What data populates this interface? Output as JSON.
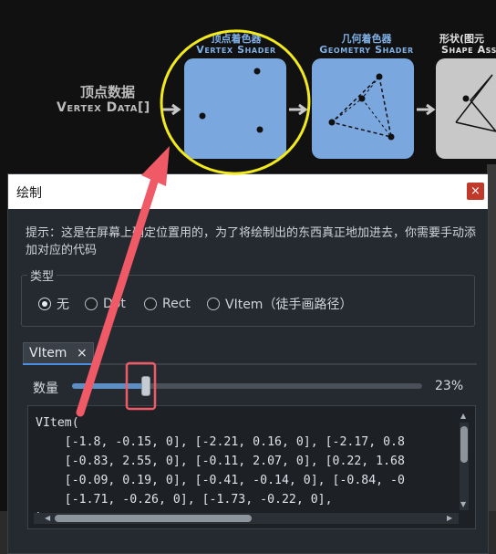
{
  "background_figure": {
    "vertex_data_label": "顶点数据",
    "vertex_data_sub": "Vertex Data[]",
    "stages": [
      {
        "title": "顶点着色器",
        "sub": "Vertex Shader"
      },
      {
        "title": "几何着色器",
        "sub": "Geometry Shader"
      },
      {
        "title": "形状(图元",
        "sub": "Shape Ass"
      }
    ]
  },
  "dialog": {
    "title": "绘制",
    "close_glyph": "×",
    "hint": "提示：这是在屏幕上确定位置用的，为了将绘制出的东西真正地加进去，你需要手动添加对应的代码",
    "type_group": {
      "label": "类型",
      "options": [
        "无",
        "Dot",
        "Rect",
        "VItem（徒手画路径）"
      ],
      "selected": "无"
    },
    "tab": {
      "label": "VItem",
      "close_glyph": "×"
    },
    "quantity": {
      "label": "数量",
      "percent_text": "23%",
      "value": 0.21
    },
    "code_lines": [
      "VItem(",
      "    [-1.8, -0.15, 0], [-2.21, 0.16, 0], [-2.17, 0.8",
      "    [-0.83, 2.55, 0], [-0.11, 2.07, 0], [0.22, 1.68",
      "    [-0.09, 0.19, 0], [-0.41, -0.14, 0], [-0.84, -0",
      "    [-1.71, -0.26, 0], [-1.73, -0.22, 0],",
      "`"
    ]
  },
  "colors": {
    "stage_blue": "#7aa7dd",
    "stage_gray": "#c8c8c8",
    "annotation_red": "#f05a67",
    "annotation_yellow": "#f2ea1c"
  }
}
